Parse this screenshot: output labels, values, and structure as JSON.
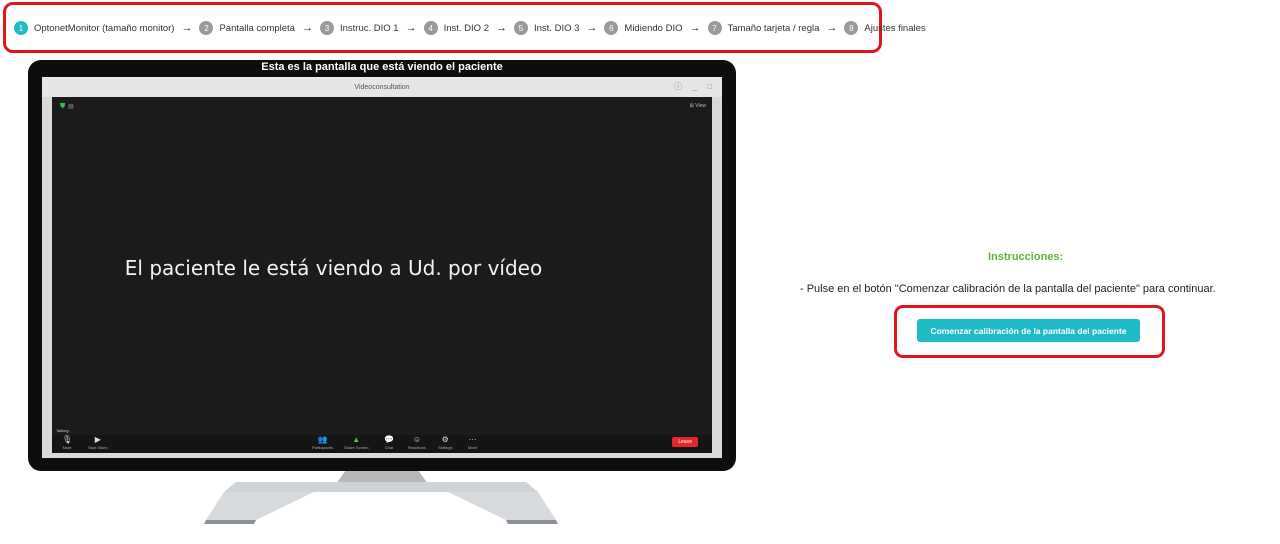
{
  "stepper": {
    "steps": [
      {
        "num": "1",
        "label": "OptonetMonitor (tamaño monitor)"
      },
      {
        "num": "2",
        "label": "Pantalla completa"
      },
      {
        "num": "3",
        "label": "Instruc. DIO 1"
      },
      {
        "num": "4",
        "label": "Inst. DIO 2"
      },
      {
        "num": "5",
        "label": "Inst. DIO 3"
      },
      {
        "num": "6",
        "label": "Midiendo DIO"
      },
      {
        "num": "7",
        "label": "Tamaño tarjeta / regla"
      },
      {
        "num": "8",
        "label": "Ajustes finales"
      }
    ],
    "arrow": "→",
    "active_step": "1",
    "active_color": "#1fbcc8",
    "highlight_color": "#e0161c"
  },
  "monitor": {
    "caption": "Esta es la pantalla que está viendo el paciente",
    "window_title": "Videoconsultation",
    "video_message": "El paciente le está viendo a Ud. por vídeo",
    "view_label": "View",
    "talking_label": "Talking:",
    "toolbar": {
      "mute": "Mute",
      "start_video": "Start Video",
      "participants": "Participants",
      "share_screen": "Share Screen",
      "chat": "Chat",
      "reactions": "Reactions",
      "settings": "Settings",
      "more": "More",
      "leave": "Leave"
    }
  },
  "instructions": {
    "title": "Instrucciones:",
    "text": "- Pulse en el botón \"Comenzar calibración de la pantalla del paciente\" para continuar.",
    "button_label": "Comenzar calibración de la pantalla del paciente",
    "title_color": "#5fb53c",
    "button_color": "#1fbcc8"
  }
}
